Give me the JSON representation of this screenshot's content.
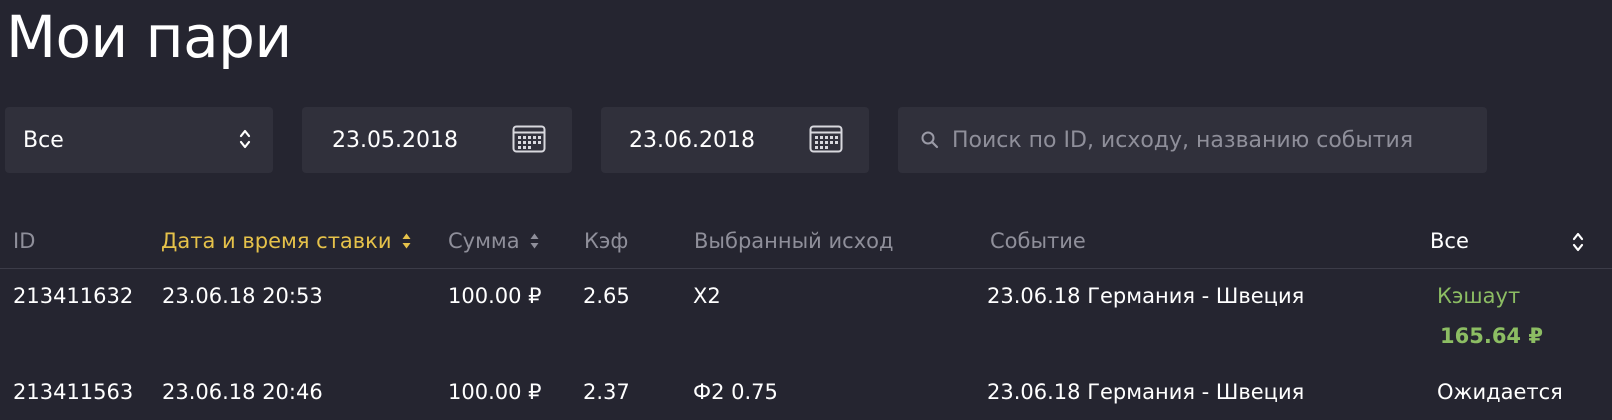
{
  "page": {
    "title": "Мои пари"
  },
  "filters": {
    "type_select": {
      "value": "Все"
    },
    "date_from": {
      "value": "23.05.2018"
    },
    "date_to": {
      "value": "23.06.2018"
    },
    "search": {
      "placeholder": "Поиск по ID, исходу, названию события"
    }
  },
  "table": {
    "columns": {
      "id": "ID",
      "datetime": "Дата и время ставки",
      "amount": "Сумма",
      "coef": "Кэф",
      "outcome": "Выбранный исход",
      "event": "Событие",
      "status": "Все"
    },
    "rows": [
      {
        "id": "213411632",
        "datetime": "23.06.18 20:53",
        "amount": "100.00 ₽",
        "coef": "2.65",
        "outcome": "X2",
        "event": "23.06.18 Германия - Швеция",
        "status": "Кэшаут",
        "cashout_amount": "165.64 ₽"
      },
      {
        "id": "213411563",
        "datetime": "23.06.18 20:46",
        "amount": "100.00 ₽",
        "coef": "2.37",
        "outcome": "Ф2 0.75",
        "event": "23.06.18 Германия - Швеция",
        "status": "Ожидается"
      }
    ]
  },
  "colors": {
    "background": "#252530",
    "field_background": "#30303b",
    "sorted_column": "#e6c24a",
    "cashout": "#8cbd63",
    "muted_text": "#8f8f9a"
  },
  "icons": {
    "select_arrows": "up-down-chevron-icon",
    "calendar": "calendar-icon",
    "search": "search-icon",
    "sort": "sort-arrows-icon"
  }
}
